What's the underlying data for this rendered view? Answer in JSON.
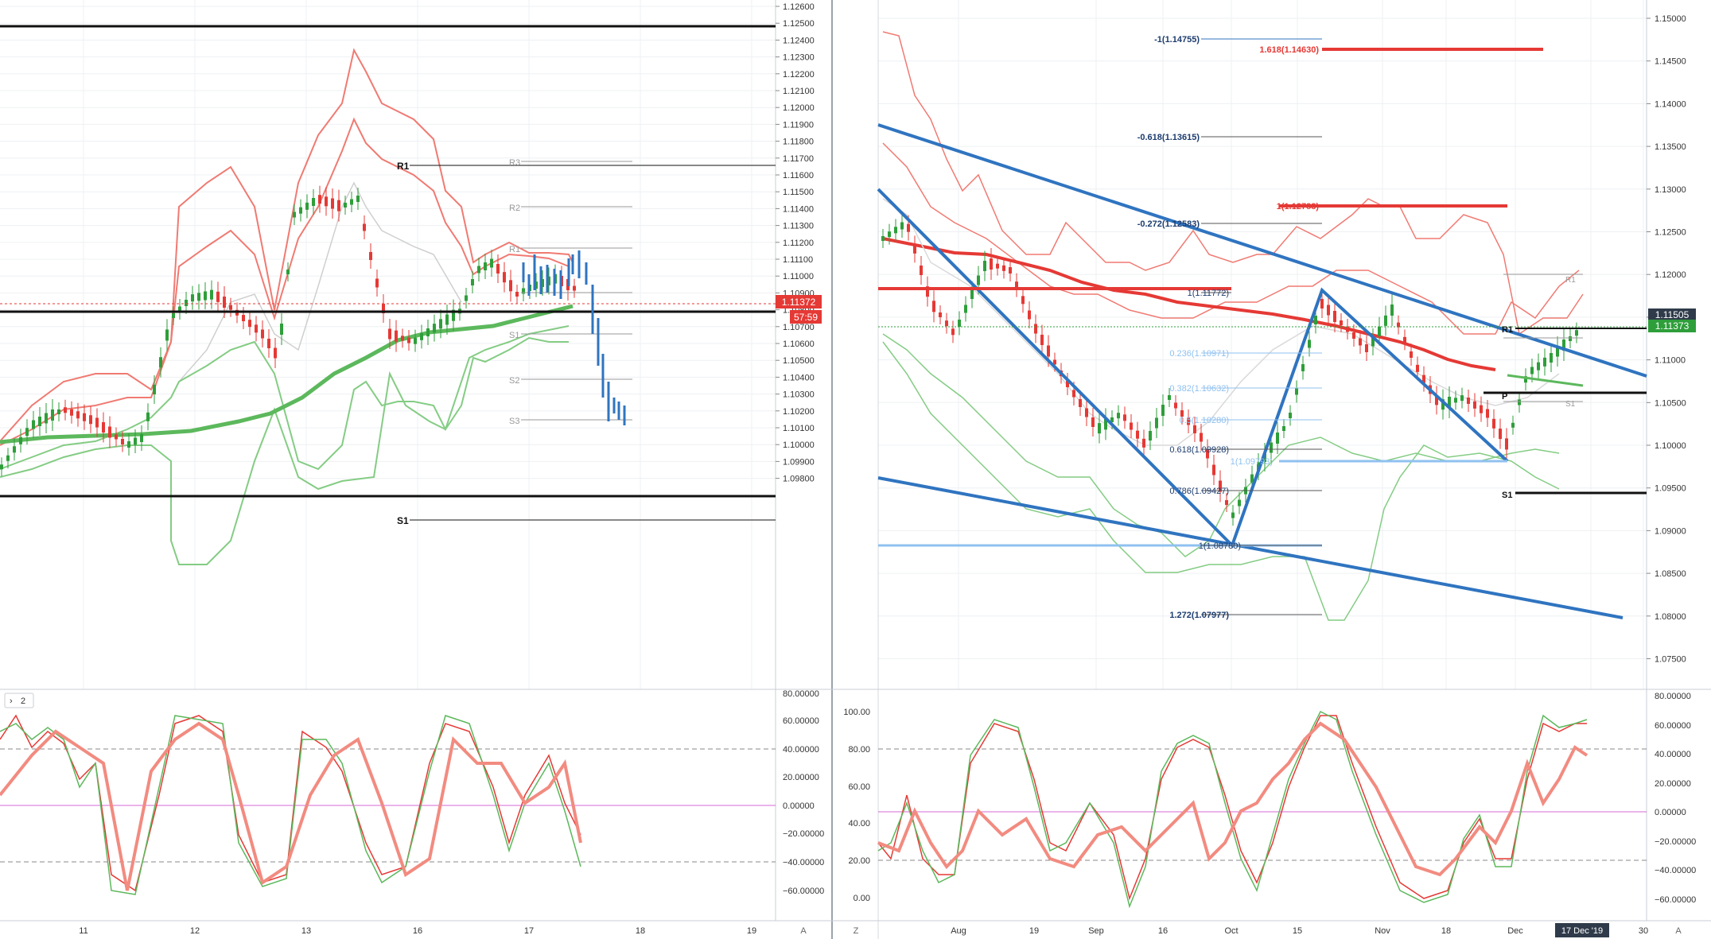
{
  "left": {
    "y_ticks": [
      "1.12600",
      "1.12500",
      "1.12400",
      "1.12300",
      "1.12200",
      "1.12100",
      "1.12000",
      "1.11900",
      "1.11800",
      "1.11700",
      "1.11600",
      "1.11500",
      "1.11400",
      "1.11300",
      "1.11200",
      "1.11100",
      "1.11000",
      "1.10900",
      "1.10800",
      "1.10700",
      "1.10600",
      "1.10500",
      "1.10400",
      "1.10300",
      "1.10200",
      "1.10100",
      "1.10000",
      "1.09900",
      "1.09800"
    ],
    "x_ticks": [
      "11",
      "12",
      "13",
      "16",
      "17",
      "18",
      "19"
    ],
    "price_label": "1.11372",
    "countdown_label": "57:59",
    "pivots": {
      "R1": "R1",
      "S1": "S1",
      "R3": "R3",
      "R2": "R2",
      "R1b": "R1",
      "S1b": "S1",
      "S2": "S2",
      "S3": "S3"
    },
    "sub_label": "2",
    "osc_ticks": [
      "80.00000",
      "60.00000",
      "40.00000",
      "20.00000",
      "0.00000",
      "−20.00000",
      "−40.00000",
      "−60.00000"
    ],
    "corner_a": "A"
  },
  "right": {
    "y_ticks": [
      "1.15000",
      "1.14500",
      "1.14000",
      "1.13500",
      "1.13000",
      "1.12500",
      "1.12000",
      "1.11500",
      "1.11000",
      "1.10500",
      "1.10000",
      "1.09500",
      "1.09000",
      "1.08500",
      "1.08000",
      "1.07500"
    ],
    "x_ticks": [
      "Aug",
      "19",
      "Sep",
      "16",
      "Oct",
      "15",
      "Nov",
      "18",
      "Dec",
      "30"
    ],
    "date_badge": "17 Dec '19",
    "price_label_1": "1.11505",
    "price_label_2": "1.11373",
    "fib_labels": [
      "-1(1.14755)",
      "1.618(1.14630)",
      "-0.618(1.13615)",
      "1(1.12783)",
      "-0.272(1.12583)",
      "1(1.11772)",
      "0.236(1.10971)",
      "0.382(1.10632)",
      "0.5(1.10280)",
      "0.618(1.09928)",
      "0.786(1.09427)",
      "1(1.08780)",
      "1.272(1.07977)",
      "1(1.09793)"
    ],
    "pivots": {
      "R1": "R1",
      "P": "P",
      "S1": "S1",
      "R1b": "R1",
      "S1b": "S1"
    },
    "osc_left_ticks": [
      "100.00",
      "80.00",
      "60.00",
      "40.00",
      "20.00",
      "0.00"
    ],
    "osc_right_ticks": [
      "80.00000",
      "60.00000",
      "40.00000",
      "20.00000",
      "0.00000",
      "−20.00000",
      "−40.00000",
      "−60.00000"
    ],
    "corner_z": "Z",
    "corner_a": "A"
  },
  "colors": {
    "bull": "#2e9e3a",
    "bear": "#e53935",
    "trend": "#2f74c0",
    "fibLight": "#90c1f0",
    "ma": "#5cb85c",
    "bandRed": "#f07a72",
    "bandGreen": "#84cc84"
  }
}
